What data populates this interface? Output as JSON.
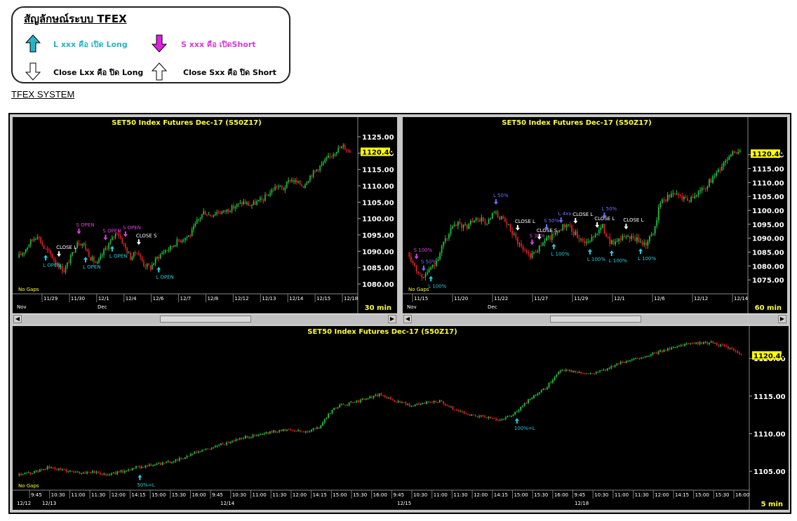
{
  "legend": {
    "title": "สัญลักษณ์ระบบ TFEX",
    "items": [
      {
        "label": "L xxx คือ เปิด Long",
        "color": "#27b5c5"
      },
      {
        "label": "S xxx คือ เปิดShort",
        "color": "#d63ad6"
      },
      {
        "label": "Close Lxx คือ ปิด Long",
        "color": "#000000"
      },
      {
        "label": "Close Sxx คือ ปิด Short",
        "color": "#000000"
      }
    ]
  },
  "system_title": "TFEX SYSTEM",
  "colors": {
    "up": "#1fc23a",
    "down": "#e02020",
    "axis_text": "#ffffff",
    "title": "#ffff33",
    "price_tag": "#ffff00",
    "long": "#20d0e0",
    "short": "#e040e0",
    "close": "#ffffff"
  },
  "chart_data": [
    {
      "id": "chart-30min",
      "type": "candlestick",
      "title": "SET50  Index  Futures  Dec-17  (S50Z17)",
      "timeframe": "30  min",
      "note": "No Gaps",
      "last_price": "1120.40",
      "ylim": [
        1077,
        1128
      ],
      "yticks": [
        "1080.00",
        "1085.00",
        "1090.00",
        "1095.00",
        "1100.00",
        "1105.00",
        "1110.00",
        "1115.00",
        "1120.00",
        "1125.00"
      ],
      "xticks": [
        "11/29",
        "11/30",
        "12/1",
        "12/4",
        "12/6",
        "12/7",
        "12/8",
        "12/12",
        "12/13",
        "12/14",
        "12/15",
        "12/18"
      ],
      "months": [
        "Nov",
        "Dec"
      ],
      "path": [
        1088,
        1090,
        1093,
        1095,
        1091,
        1089,
        1086,
        1084,
        1088,
        1093,
        1092,
        1088,
        1086,
        1090,
        1093,
        1096,
        1092,
        1088,
        1090,
        1086,
        1085,
        1088,
        1090,
        1091,
        1093,
        1094,
        1095,
        1099,
        1102,
        1101,
        1102,
        1102,
        1103,
        1104,
        1105,
        1104,
        1105,
        1106,
        1108,
        1110,
        1109,
        1112,
        1111,
        1110,
        1113,
        1115,
        1117,
        1119,
        1121,
        1122,
        1120.4
      ],
      "signals": [
        {
          "label": "L  OPEN",
          "kind": "long",
          "i": 4
        },
        {
          "label": "CLOSE  L",
          "kind": "close",
          "i": 6
        },
        {
          "label": "S  OPEN",
          "kind": "short",
          "i": 9
        },
        {
          "label": "L  OPEN",
          "kind": "long",
          "i": 10
        },
        {
          "label": "S  OPEN",
          "kind": "short",
          "i": 13
        },
        {
          "label": "L  OPEN",
          "kind": "long",
          "i": 14
        },
        {
          "label": "S  OPEN",
          "kind": "short",
          "i": 16
        },
        {
          "label": "CLOSE  S",
          "kind": "close",
          "i": 18
        },
        {
          "label": "L  OPEN",
          "kind": "long",
          "i": 21
        }
      ]
    },
    {
      "id": "chart-60min",
      "type": "candlestick",
      "title": "SET50  Index  Futures  Dec-17  (S50Z17)",
      "timeframe": "60  min",
      "note": "No Gaps",
      "last_price": "1120.40",
      "ylim": [
        1070,
        1130
      ],
      "yticks": [
        "1075.00",
        "1080.00",
        "1085.00",
        "1090.00",
        "1095.00",
        "1100.00",
        "1105.00",
        "1110.00",
        "1115.00",
        "1120.00"
      ],
      "xticks": [
        "11/15",
        "11/20",
        "11/22",
        "11/27",
        "11/29",
        "12/1",
        "12/6",
        "12/12",
        "12/14"
      ],
      "months": [
        "Nov",
        "Dec"
      ],
      "path": [
        1085,
        1080,
        1076,
        1078,
        1082,
        1088,
        1093,
        1095,
        1094,
        1096,
        1097,
        1095,
        1099,
        1097,
        1094,
        1090,
        1086,
        1084,
        1086,
        1089,
        1091,
        1093,
        1095,
        1092,
        1090,
        1088,
        1092,
        1094,
        1089,
        1088,
        1091,
        1090,
        1089,
        1088,
        1092,
        1103,
        1105,
        1106,
        1105,
        1104,
        1106,
        1108,
        1111,
        1114,
        1118,
        1121,
        1120.4
      ],
      "signals": [
        {
          "label": "S  100%",
          "kind": "short",
          "i": 1
        },
        {
          "label": "S  50%",
          "kind": "short-alt",
          "i": 2
        },
        {
          "label": "L  100%",
          "kind": "long",
          "i": 3
        },
        {
          "label": "L  50%",
          "kind": "short-alt",
          "i": 12
        },
        {
          "label": "CLOSE  L",
          "kind": "close",
          "i": 15
        },
        {
          "label": "S  30%",
          "kind": "short",
          "i": 17
        },
        {
          "label": "CLOSE  S",
          "kind": "close",
          "i": 18
        },
        {
          "label": "S  50%",
          "kind": "short-alt",
          "i": 19
        },
        {
          "label": "L  100%",
          "kind": "long",
          "i": 20
        },
        {
          "label": "L  4xx",
          "kind": "short-alt",
          "i": 21
        },
        {
          "label": "CLOSE  L",
          "kind": "close",
          "i": 23
        },
        {
          "label": "L  100%",
          "kind": "long",
          "i": 25
        },
        {
          "label": "CLOSE  L",
          "kind": "close",
          "i": 26
        },
        {
          "label": "L  50%",
          "kind": "short-alt",
          "i": 27
        },
        {
          "label": "L  100%",
          "kind": "long",
          "i": 28
        },
        {
          "label": "CLOSE  L",
          "kind": "close",
          "i": 30
        },
        {
          "label": "L  100%",
          "kind": "long",
          "i": 32
        }
      ]
    },
    {
      "id": "chart-5min",
      "type": "candlestick",
      "title": "SET50  Index  Futures  Dec-17  (S50Z17)",
      "timeframe": "5  min",
      "note": "No Gaps",
      "last_price": "1120.40",
      "ylim": [
        1102.5,
        1123
      ],
      "yticks": [
        "1105.00",
        "1110.00",
        "1115.00",
        "1120.00"
      ],
      "xticks": [
        "9:45",
        "10:30",
        "11:00",
        "11:30",
        "12:00",
        "14:15",
        "15:00",
        "15:30",
        "16:00",
        "9:45",
        "10:30",
        "11:00",
        "11:30",
        "12:00",
        "14:15",
        "15:00",
        "15:30",
        "16:00",
        "9:45",
        "10:30",
        "11:00",
        "11:30",
        "12:00",
        "14:15",
        "15:00",
        "15:30",
        "16:00",
        "9:45",
        "10:30",
        "11:00",
        "11:30",
        "12:00",
        "14:15",
        "15:00",
        "15:30",
        "16:00"
      ],
      "dates": [
        "12/12",
        "12/13",
        "12/14",
        "12/15",
        "12/18"
      ],
      "path": [
        1104.5,
        1104.8,
        1105.5,
        1105.2,
        1104.8,
        1104.9,
        1104.6,
        1105.0,
        1105.6,
        1105.8,
        1106.2,
        1106.8,
        1107.6,
        1108.2,
        1108.9,
        1109.5,
        1109.8,
        1110.3,
        1110.6,
        1110.2,
        1110.8,
        1113.5,
        1114.0,
        1114.6,
        1115.2,
        1114.4,
        1113.8,
        1114.1,
        1114.3,
        1113.2,
        1112.5,
        1112.2,
        1111.8,
        1112.8,
        1114.6,
        1116.0,
        1118.5,
        1118.2,
        1118.0,
        1118.6,
        1119.4,
        1120.0,
        1120.5,
        1121.2,
        1121.8,
        1122.0,
        1122.1,
        1121.5,
        1120.4
      ],
      "signals": [
        {
          "label": "50%=L",
          "kind": "long",
          "i": 8
        },
        {
          "label": "100%=L",
          "kind": "long",
          "i": 33
        }
      ]
    }
  ]
}
